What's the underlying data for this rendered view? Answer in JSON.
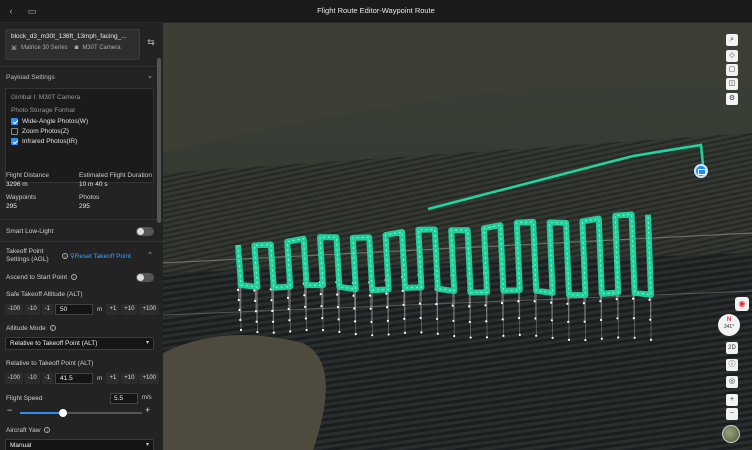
{
  "window": {
    "title": "Flight Route Editor-Waypoint Route",
    "back_icon": "chevron-left-icon",
    "save_icon": "save-icon"
  },
  "route_card": {
    "name": "block_d3_m30t_136ft_13mph_facing_...",
    "aircraft": "Matrice 30 Series",
    "camera": "M30T Camera",
    "aircraft_icon": "drone-icon",
    "camera_icon": "camera-icon",
    "swap_icon": "swap-icon"
  },
  "payload": {
    "header": "Payload Settings",
    "gimbal": "Gimbal I: M30T Camera",
    "storage_label": "Photo Storage Format",
    "options": [
      {
        "label": "Wide-Angle Photos(W)",
        "checked": true
      },
      {
        "label": "Zoom Photos(Z)",
        "checked": false
      },
      {
        "label": "Infrared Photos(IR)",
        "checked": true
      }
    ]
  },
  "stats": {
    "distance_label": "Flight Distance",
    "distance_value": "3296 m",
    "duration_label": "Estimated Flight Duration",
    "duration_value": "10 m 40 s",
    "waypoints_label": "Waypoints",
    "waypoints_value": "295",
    "photos_label": "Photos",
    "photos_value": "295"
  },
  "settings": {
    "smart_low_light": "Smart Low-Light",
    "takeoff_header": "Takeoff Point Settings (AGL)",
    "reset_takeoff": "Reset Takeoff Point",
    "ascend_label": "Ascend to Start Point",
    "safe_alt_label": "Safe Takeoff Altitude (ALT)",
    "safe_alt_value": "50",
    "unit_m": "m",
    "step_minus100": "-100",
    "step_minus10": "-10",
    "step_minus1": "-1",
    "step_plus1": "+1",
    "step_plus10": "+10",
    "step_plus100": "+100",
    "altitude_mode_label": "Altitude Mode",
    "altitude_mode_value": "Relative to Takeoff Point (ALT)",
    "relative_label": "Relative to Takeoff Point (ALT)",
    "relative_value": "41.5",
    "speed_label": "Flight Speed",
    "speed_value": "5.5",
    "speed_unit": "m/s",
    "speed_fraction": 0.35,
    "yaw_label": "Aircraft Yaw",
    "yaw_value": "Manual"
  },
  "map": {
    "compass_letter": "N",
    "compass_heading": "341°",
    "btn_2d": "2D",
    "zoom_in": "+",
    "zoom_out": "−",
    "route_color": "#1fd6a0"
  }
}
